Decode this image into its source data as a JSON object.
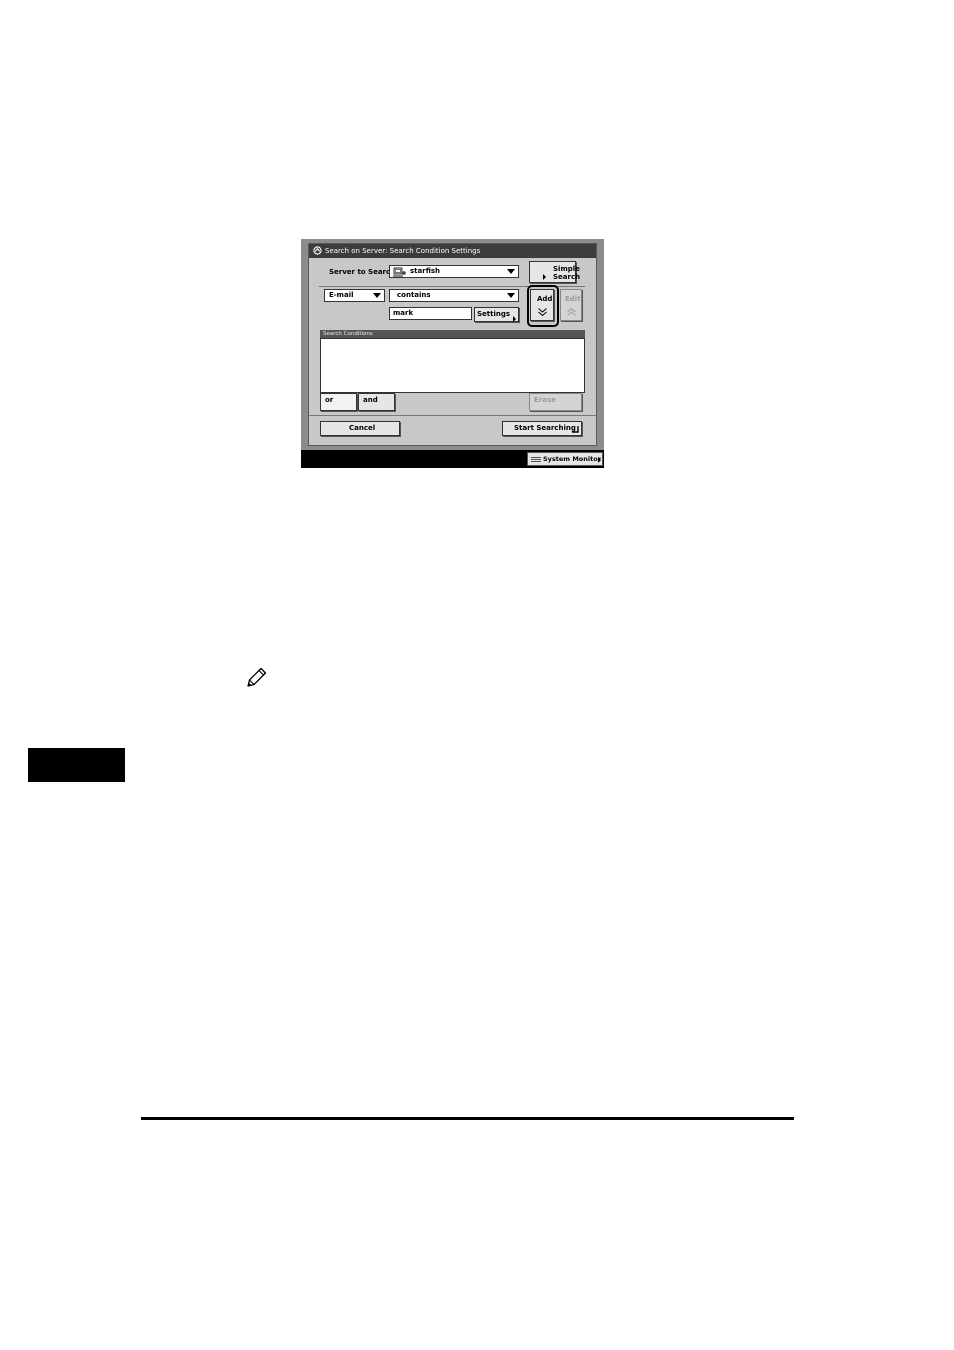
{
  "dialog": {
    "title": "Search on Server: Search Condition Settings",
    "server_label": "Server to Search:",
    "server_value": "starfish",
    "simple_search_label": [
      "Simple",
      "Search"
    ],
    "field_select": "E-mail",
    "operator_select": "contains",
    "keyword_value": "mark",
    "settings_label": "Settings",
    "add_label": "Add",
    "edit_label": "Edit",
    "conditions_header": "Search Conditions",
    "or_label": "or",
    "and_label": "and",
    "erase_label": "Erase",
    "cancel_label": "Cancel",
    "start_label": "Start Searching",
    "system_monitor_label": "System Monitor"
  },
  "icons": {
    "title": "search-server-icon",
    "server": "server-computer-icon",
    "note": "pencil-note-icon"
  }
}
